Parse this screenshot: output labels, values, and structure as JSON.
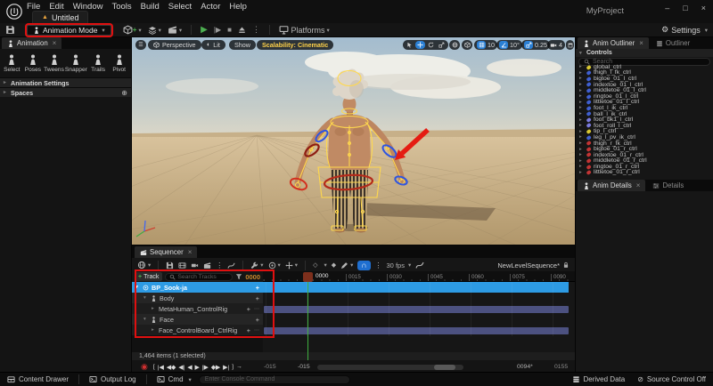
{
  "colors": {
    "accent_blue": "#2d9be4",
    "section_purple": "#4c5180",
    "annotation_red": "#e01010",
    "frame_orange": "#c8872c",
    "scalability_yellow": "#ffd24a",
    "playhead_green": "#3fae3f",
    "record_red": "#d03030"
  },
  "glyphs": {
    "chevron": "▾",
    "caret": "▸",
    "caret_open": "▾",
    "close": "×",
    "dots": "⋮",
    "ellipsis": "⋯",
    "plus": "+",
    "menu": "☰",
    "play": "▶",
    "step": "|▶",
    "stop": "■",
    "gear": "⚙",
    "magnet": "∩",
    "diamond": "◆",
    "diamond_open": "◇",
    "half": "◐",
    "circle_plus": "⊕",
    "warning": "▲",
    "no_entry": "⊘"
  },
  "titlebar": {
    "project": "MyProject",
    "tab": "Untitled",
    "menus": [
      "File",
      "Edit",
      "Window",
      "Tools",
      "Build",
      "Select",
      "Actor",
      "Help"
    ],
    "window": {
      "min": "–",
      "max": "□",
      "close": "×"
    }
  },
  "toolbar": {
    "mode": "Animation Mode",
    "platforms": "Platforms",
    "settings": "Settings"
  },
  "anim_panel": {
    "tab": "Animation",
    "tools": [
      {
        "label": "Select"
      },
      {
        "label": "Poses"
      },
      {
        "label": "Tweens"
      },
      {
        "label": "Snapper"
      },
      {
        "label": "Trails"
      },
      {
        "label": "Pivot"
      }
    ],
    "sections": {
      "settings": "Animation Settings",
      "spaces": "Spaces"
    }
  },
  "viewport": {
    "perspective": "Perspective",
    "lit": "Lit",
    "show": "Show",
    "scalability": "Scalability: Cinematic",
    "snap_grid": "10",
    "snap_angle": "10°",
    "snap_scale": "0.25",
    "camera_speed": "4"
  },
  "outliner": {
    "tab": "Anim Outliner",
    "tab2": "Outliner",
    "header": "Controls",
    "search": "Search",
    "controls": [
      {
        "name": "global_ctrl",
        "color": "#d9c832"
      },
      {
        "name": "thigh_l_fk_ctrl",
        "color": "#3f5fd0"
      },
      {
        "name": "bigtoe_01_l_ctrl",
        "color": "#3f5fd0"
      },
      {
        "name": "indextoe_01_l_ctrl",
        "color": "#3f5fd0"
      },
      {
        "name": "middletoe_01_l_ctrl",
        "color": "#3f5fd0"
      },
      {
        "name": "ringtoe_01_l_ctrl",
        "color": "#3f5fd0"
      },
      {
        "name": "littletoe_01_l_ctrl",
        "color": "#3f5fd0"
      },
      {
        "name": "foot_l_ik_ctrl",
        "color": "#3f5fd0"
      },
      {
        "name": "ball_l_ik_ctrl",
        "color": "#3f5fd0"
      },
      {
        "name": "foot_bk1_l_ctrl",
        "color": "#7b7bdf"
      },
      {
        "name": "foot_roll_l_ctrl",
        "color": "#7b7bdf"
      },
      {
        "name": "tip_l_ctrl",
        "color": "#d9c832"
      },
      {
        "name": "leg_l_pv_ik_ctrl",
        "color": "#3f5fd0"
      },
      {
        "name": "thigh_r_fk_ctrl",
        "color": "#c23434"
      },
      {
        "name": "bigtoe_01_r_ctrl",
        "color": "#c23434"
      },
      {
        "name": "indextoe_01_r_ctrl",
        "color": "#c23434"
      },
      {
        "name": "middletoe_01_r_ctrl",
        "color": "#c23434"
      },
      {
        "name": "ringtoe_01_r_ctrl",
        "color": "#c23434"
      },
      {
        "name": "littletoe_01_r_ctrl",
        "color": "#c23434"
      }
    ],
    "details_tab": "Anim Details",
    "details_tab2": "Details"
  },
  "sequencer": {
    "tab": "Sequencer",
    "sequence_name": "NewLevelSequence*",
    "fps": "30 fps",
    "add_plus": "+",
    "add_label": "Track",
    "search": "Search Tracks",
    "current_frame": "0000",
    "playhead_label": "0000",
    "ticks": [
      "0015",
      "0030",
      "0045",
      "0060",
      "0075",
      "0090"
    ],
    "tracks": [
      {
        "name": "BP_Sook-ja"
      },
      {
        "name": "Body"
      },
      {
        "name": "MetaHuman_ControlRig"
      },
      {
        "name": "Face"
      },
      {
        "name": "Face_ControlBoard_CtrlRig"
      }
    ],
    "status": "1,464 items (1 selected)",
    "record": "◉",
    "transport": [
      "[",
      "|◀",
      "◀◆",
      "◀|",
      "◀",
      "▶",
      "|▶",
      "◆▶",
      "▶|",
      "]",
      "→"
    ],
    "range": {
      "start_a": "-015",
      "start_b": "-015",
      "end_a": "0094*",
      "end_b": "0155"
    }
  },
  "statusbar": {
    "content_drawer": "Content Drawer",
    "output_log": "Output Log",
    "cmd": "Cmd",
    "console": "Enter Console Command",
    "derived": "Derived Data",
    "source_control": "Source Control Off"
  }
}
